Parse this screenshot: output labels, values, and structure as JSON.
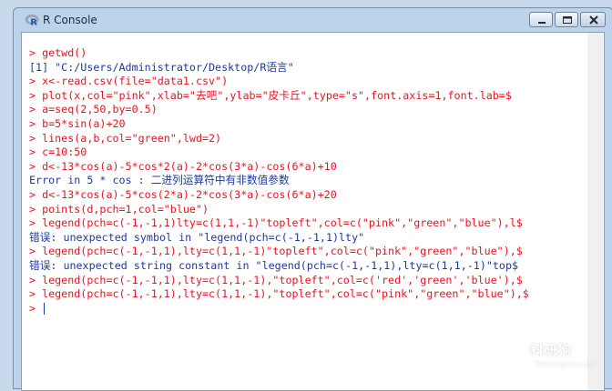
{
  "window": {
    "title": "R Console",
    "icon": "r-logo-icon"
  },
  "titlebar_buttons": {
    "minimize": "minimize-icon",
    "maximize": "maximize-icon",
    "close": "close-icon"
  },
  "console": {
    "lines": [
      {
        "kind": "cmd",
        "text": "> getwd()"
      },
      {
        "kind": "out",
        "text": "[1] \"C:/Users/Administrator/Desktop/R语言\""
      },
      {
        "kind": "cmd",
        "text": "> x<-read.csv(file=\"data1.csv\")"
      },
      {
        "kind": "cmd",
        "text": "> plot(x,col=\"pink\",xlab=\"去吧\",ylab=\"皮卡丘\",type=\"s\",font.axis=1,font.lab=$"
      },
      {
        "kind": "cmd",
        "text": "> a=seq(2,50,by=0.5)"
      },
      {
        "kind": "cmd",
        "text": "> b=5*sin(a)+20"
      },
      {
        "kind": "cmd",
        "text": "> lines(a,b,col=\"green\",lwd=2)"
      },
      {
        "kind": "cmd",
        "text": "> c=10:50"
      },
      {
        "kind": "cmd",
        "text": "> d<-13*cos(a)-5*cos*2(a)-2*cos(3*a)-cos(6*a)+10"
      },
      {
        "kind": "out",
        "text": "Error in 5 * cos : 二进列运算符中有非数值参数"
      },
      {
        "kind": "cmd",
        "text": "> d<-13*cos(a)-5*cos(2*a)-2*cos(3*a)-cos(6*a)+20"
      },
      {
        "kind": "cmd",
        "text": "> points(d,pch=1,col=\"blue\")"
      },
      {
        "kind": "cmd",
        "text": "> legend(pch=c(-1,-1,1)lty=c(1,1,-1)\"topleft\",col=c(\"pink\",\"green\",\"blue\"),l$"
      },
      {
        "kind": "out",
        "text": "错误: unexpected symbol in \"legend(pch=c(-1,-1,1)lty\""
      },
      {
        "kind": "cmd",
        "text": "> legend(pch=c(-1,-1,1),lty=c(1,1,-1)\"topleft\",col=c(\"pink\",\"green\",\"blue\"),$"
      },
      {
        "kind": "out",
        "text": "错误: unexpected string constant in \"legend(pch=c(-1,-1,1),lty=c(1,1,-1)\"top$"
      },
      {
        "kind": "cmd",
        "text": "> legend(pch=c(-1,-1,1),lty=c(1,1,-1),\"topleft\",col=c('red','green','blue'),$"
      },
      {
        "kind": "cmd",
        "text": "> legend(pch=c(-1,-1,1),lty=c(1,1,-1),\"topleft\",col=c(\"pink\",\"green\",\"blue\"),$"
      },
      {
        "kind": "cmd",
        "text": "> "
      }
    ]
  },
  "watermark": {
    "brand_cn": "科研狗",
    "brand_en": "Keyangou.com",
    "icon": "dog-logo-icon"
  },
  "colors": {
    "command": "#e8141f",
    "output": "#1f3a98",
    "console_bg": "#ffffff",
    "frame": "#bcd3ec"
  }
}
